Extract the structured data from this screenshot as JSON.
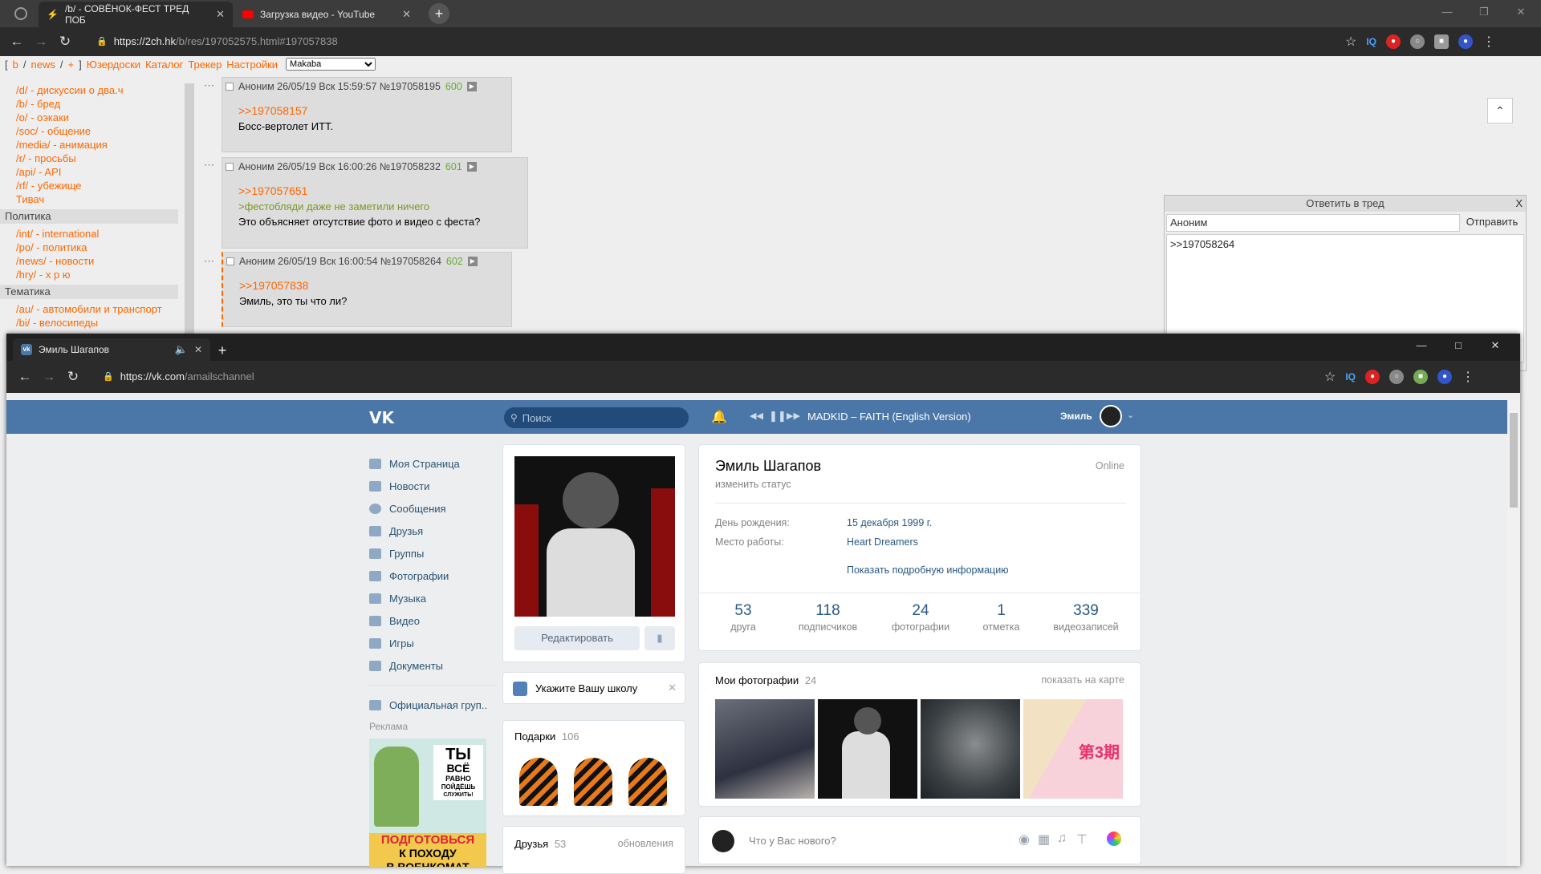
{
  "browser1": {
    "tabs": [
      {
        "label": "/b/ - СОВЁНОК-ФЕСТ ТРЕД ПОБ"
      },
      {
        "label": "Загрузка видео - YouTube"
      }
    ],
    "url_main": "https://2ch.hk",
    "url_rest": "/b/res/197052575.html#197057838"
  },
  "board_nav": {
    "bracket_open": "[",
    "items": [
      "b",
      "/",
      "news",
      "/",
      "+"
    ],
    "bracket_close": "]",
    "links": [
      "Юзердоски",
      "Каталог",
      "Трекер",
      "Настройки"
    ],
    "style_select": "Makaba"
  },
  "sidebar": {
    "links_top": [
      "/d/ - дискуссии о два.ч",
      "/b/ - бред",
      "/o/ - оэкаки",
      "/soc/ - общение",
      "/media/ - анимация",
      "/r/ - просьбы",
      "/api/ - API",
      "/rf/ - убежище",
      "Тивач"
    ],
    "section_politics": "Политика",
    "links_politics": [
      "/int/ - international",
      "/po/ - политика",
      "/news/ - новости",
      "/hry/ - х р ю"
    ],
    "section_theme": "Тематика",
    "links_theme": [
      "/au/ - автомобили и транспорт",
      "/bi/ - велосипеды"
    ]
  },
  "posts": [
    {
      "header": "Аноним 26/05/19 Вск 15:59:57 №197058195",
      "num": "600",
      "ref": ">>197058157",
      "quote": "",
      "text": "Босс-вертолет ИТТ."
    },
    {
      "header": "Аноним 26/05/19 Вск 16:00:26 №197058232",
      "num": "601",
      "ref": ">>197057651",
      "quote": ">фестобляди даже не заметили ничего",
      "text": "Это объясняет отсутствие фото и видео с феста?"
    },
    {
      "header": "Аноним 26/05/19 Вск 16:00:54 №197058264",
      "num": "602",
      "ref": ">>197057838",
      "quote": "",
      "text": "Эмиль, это ты что ли?"
    }
  ],
  "reply_form": {
    "title": "Ответить в тред",
    "close": "X",
    "name_value": "Аноним",
    "send": "Отправить",
    "text_value": ">>197058264"
  },
  "browser2": {
    "tab_label": "Эмиль Шагапов",
    "url_main": "https://vk.com",
    "url_rest": "/amailschannel"
  },
  "vk": {
    "search_placeholder": "Поиск",
    "track": "MADKID – FAITH (English Version)",
    "username": "Эмиль",
    "menu": [
      "Моя Страница",
      "Новости",
      "Сообщения",
      "Друзья",
      "Группы",
      "Фотографии",
      "Музыка",
      "Видео",
      "Игры",
      "Документы"
    ],
    "official_group": "Официальная груп..",
    "ads_label": "Реклама",
    "ad_text": [
      "ТЫ",
      "ВСЁ",
      "РАВНО",
      "ПОЙДЁШЬ",
      "СЛУЖИТЬ!",
      "ПОДГОТОВЬСЯ",
      "К ПОХОДУ",
      "В ВОЕНКОМАТ"
    ],
    "edit_button": "Редактировать",
    "school_prompt": "Укажите Вашу школу",
    "gifts_label": "Подарки",
    "gifts_count": "106",
    "friends_label": "Друзья",
    "friends_count": "53",
    "friends_updates": "обновления",
    "profile": {
      "name": "Эмиль Шагапов",
      "online": "Online",
      "status": "изменить статус",
      "birthday_label": "День рождения:",
      "birthday_value": "15 декабря 1999 г.",
      "work_label": "Место работы:",
      "work_value": "Heart Dreamers",
      "more_info": "Показать подробную информацию"
    },
    "counters": [
      {
        "value": "53",
        "label": "друга"
      },
      {
        "value": "118",
        "label": "подписчиков"
      },
      {
        "value": "24",
        "label": "фотографии"
      },
      {
        "value": "1",
        "label": "отметка"
      },
      {
        "value": "339",
        "label": "видеозаписей"
      }
    ],
    "photos_label": "Мои фотографии",
    "photos_count": "24",
    "photos_map": "показать на карте",
    "new_post_placeholder": "Что у Вас нового?"
  }
}
